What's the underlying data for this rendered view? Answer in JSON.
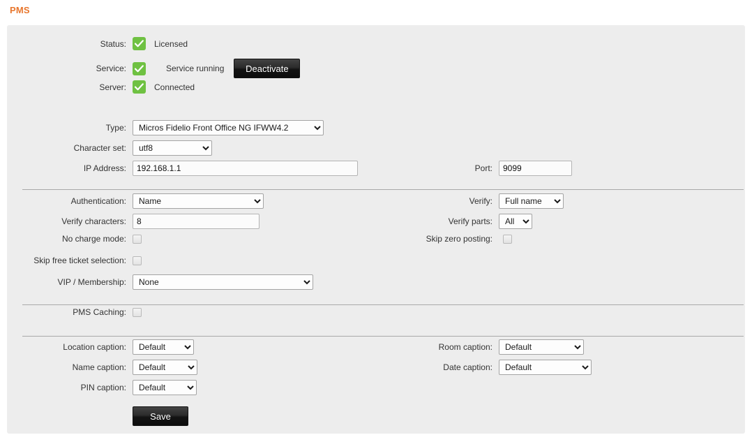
{
  "page": {
    "title": "PMS",
    "title_color": "#e8772e",
    "panel_bg": "#ededed"
  },
  "status_block": {
    "rows": [
      {
        "label": "Status:",
        "icon": "green-check-icon",
        "value": "Licensed"
      },
      {
        "label": "Service:",
        "icon": "green-check-icon",
        "value": "Service running"
      },
      {
        "label": "Server:",
        "icon": "green-check-icon",
        "value": "Connected"
      }
    ],
    "deactivate_button": "Deactivate"
  },
  "connection": {
    "type": {
      "label": "Type:",
      "value": "Micros Fidelio Front Office NG IFWW4.2",
      "options": [
        "Micros Fidelio Front Office NG IFWW4.2"
      ]
    },
    "character_set": {
      "label": "Character set:",
      "value": "utf8",
      "options": [
        "utf8"
      ]
    },
    "ip_address": {
      "label": "IP Address:",
      "value": "192.168.1.1"
    },
    "port": {
      "label": "Port:",
      "value": "9099"
    }
  },
  "authentication": {
    "authentication": {
      "label": "Authentication:",
      "value": "Name",
      "options": [
        "Name"
      ]
    },
    "verify_characters": {
      "label": "Verify characters:",
      "value": "8"
    },
    "no_charge_mode": {
      "label": "No charge mode:",
      "checked": false
    },
    "skip_free_ticket_selection": {
      "label": "Skip free ticket selection:",
      "checked": false
    },
    "vip_membership": {
      "label": "VIP / Membership:",
      "value": "None",
      "options": [
        "None"
      ]
    },
    "verify": {
      "label": "Verify:",
      "value": "Full name",
      "options": [
        "Full name"
      ]
    },
    "verify_parts": {
      "label": "Verify parts:",
      "value": "All",
      "options": [
        "All"
      ]
    },
    "skip_zero_posting": {
      "label": "Skip zero posting:",
      "checked": false
    }
  },
  "caching": {
    "pms_caching": {
      "label": "PMS Caching:",
      "checked": false
    }
  },
  "captions": {
    "location_caption": {
      "label": "Location caption:",
      "value": "Default",
      "options": [
        "Default"
      ]
    },
    "name_caption": {
      "label": "Name caption:",
      "value": "Default",
      "options": [
        "Default"
      ]
    },
    "pin_caption": {
      "label": "PIN caption:",
      "value": "Default",
      "options": [
        "Default"
      ]
    },
    "room_caption": {
      "label": "Room caption:",
      "value": "Default",
      "options": [
        "Default"
      ]
    },
    "date_caption": {
      "label": "Date caption:",
      "value": "Default",
      "options": [
        "Default"
      ]
    }
  },
  "actions": {
    "save_label": "Save"
  }
}
